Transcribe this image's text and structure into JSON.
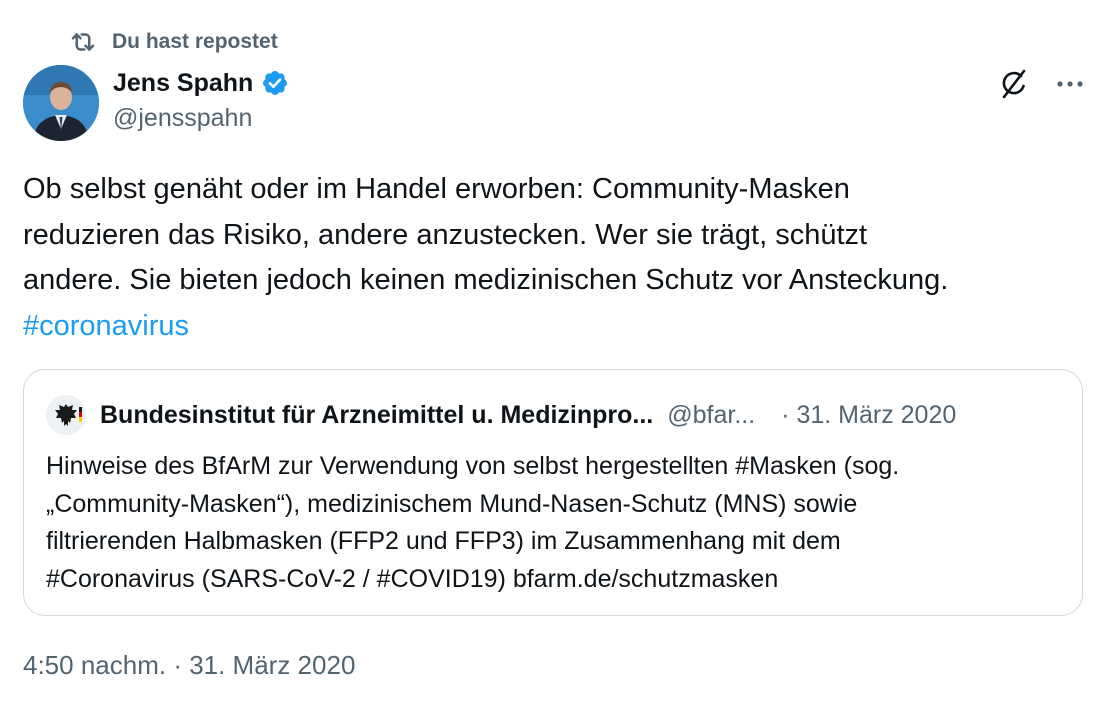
{
  "repost": {
    "label": "Du hast repostet",
    "icon": "repost-icon"
  },
  "author": {
    "name": "Jens Spahn",
    "handle": "@jensspahn",
    "verified": true,
    "verified_color": "#1d9bf0",
    "avatar": "avatar-photo"
  },
  "actions": {
    "grok_icon": "grok-icon",
    "more_icon": "more-icon"
  },
  "tweet": {
    "lines": [
      "Ob selbst genäht oder im Handel erworben: Community-Masken",
      "reduzieren das Risiko, andere anzustecken. Wer sie trägt, schützt",
      "andere. Sie bieten jedoch keinen medizinischen Schutz vor Ansteckung."
    ],
    "hashtag": "#coronavirus",
    "hashtag_color": "#1d9bf0"
  },
  "quoted": {
    "avatar": "federal-eagle-logo",
    "name": "Bundesinstitut für Arzneimittel u. Medizinpro...",
    "handle": "@bfar...",
    "date": "· 31. März 2020",
    "lines": [
      "Hinweise des BfArM zur Verwendung von selbst hergestellten #Masken (sog.",
      "„Community-Masken“), medizinischem Mund-Nasen-Schutz (MNS) sowie",
      "filtrierenden Halbmasken (FFP2 und FFP3) im Zusammenhang mit dem",
      "#Coronavirus (SARS-CoV-2 / #COVID19) bfarm.de/schutzmasken"
    ]
  },
  "timestamp": "4:50 nachm. · 31. März 2020",
  "colors": {
    "text": "#0f1419",
    "secondary": "#536471",
    "border": "#cfd9de"
  }
}
